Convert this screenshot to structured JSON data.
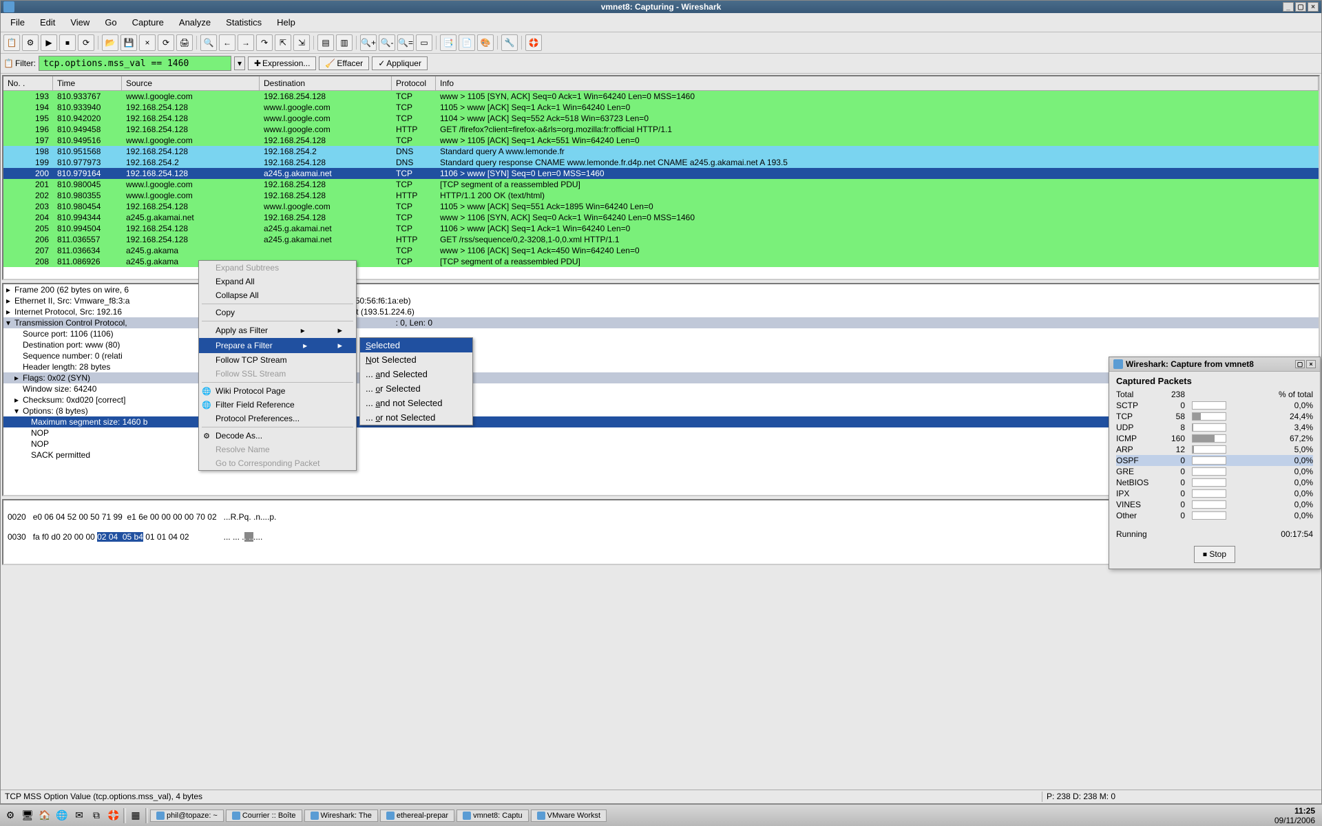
{
  "window": {
    "title": "vmnet8: Capturing - Wireshark"
  },
  "menubar": [
    "File",
    "Edit",
    "View",
    "Go",
    "Capture",
    "Analyze",
    "Statistics",
    "Help"
  ],
  "filter": {
    "label": "Filter:",
    "value": "tcp.options.mss_val == 1460",
    "expression": "Expression...",
    "clear": "Effacer",
    "apply": "Appliquer"
  },
  "columns": {
    "no": "No. .",
    "time": "Time",
    "src": "Source",
    "dst": "Destination",
    "proto": "Protocol",
    "info": "Info"
  },
  "packets": [
    {
      "no": "193",
      "time": "810.933767",
      "src": "www.l.google.com",
      "dst": "192.168.254.128",
      "proto": "TCP",
      "info": "www > 1105 [SYN, ACK] Seq=0 Ack=1 Win=64240 Len=0 MSS=1460",
      "cls": "green"
    },
    {
      "no": "194",
      "time": "810.933940",
      "src": "192.168.254.128",
      "dst": "www.l.google.com",
      "proto": "TCP",
      "info": "1105 > www [ACK] Seq=1 Ack=1 Win=64240 Len=0",
      "cls": "green"
    },
    {
      "no": "195",
      "time": "810.942020",
      "src": "192.168.254.128",
      "dst": "www.l.google.com",
      "proto": "TCP",
      "info": "1104 > www [ACK] Seq=552 Ack=518 Win=63723 Len=0",
      "cls": "green"
    },
    {
      "no": "196",
      "time": "810.949458",
      "src": "192.168.254.128",
      "dst": "www.l.google.com",
      "proto": "HTTP",
      "info": "GET /firefox?client=firefox-a&rls=org.mozilla:fr:official HTTP/1.1",
      "cls": "green"
    },
    {
      "no": "197",
      "time": "810.949516",
      "src": "www.l.google.com",
      "dst": "192.168.254.128",
      "proto": "TCP",
      "info": "www > 1105 [ACK] Seq=1 Ack=551 Win=64240 Len=0",
      "cls": "green"
    },
    {
      "no": "198",
      "time": "810.951568",
      "src": "192.168.254.128",
      "dst": "192.168.254.2",
      "proto": "DNS",
      "info": "Standard query A www.lemonde.fr",
      "cls": "blue"
    },
    {
      "no": "199",
      "time": "810.977973",
      "src": "192.168.254.2",
      "dst": "192.168.254.128",
      "proto": "DNS",
      "info": "Standard query response CNAME www.lemonde.fr.d4p.net CNAME a245.g.akamai.net A 193.5",
      "cls": "blue"
    },
    {
      "no": "200",
      "time": "810.979164",
      "src": "192.168.254.128",
      "dst": "a245.g.akamai.net",
      "proto": "TCP",
      "info": "1106 > www [SYN] Seq=0 Len=0 MSS=1460",
      "cls": "darkblue"
    },
    {
      "no": "201",
      "time": "810.980045",
      "src": "www.l.google.com",
      "dst": "192.168.254.128",
      "proto": "TCP",
      "info": "[TCP segment of a reassembled PDU]",
      "cls": "green"
    },
    {
      "no": "202",
      "time": "810.980355",
      "src": "www.l.google.com",
      "dst": "192.168.254.128",
      "proto": "HTTP",
      "info": "HTTP/1.1 200 OK (text/html)",
      "cls": "green"
    },
    {
      "no": "203",
      "time": "810.980454",
      "src": "192.168.254.128",
      "dst": "www.l.google.com",
      "proto": "TCP",
      "info": "1105 > www [ACK] Seq=551 Ack=1895 Win=64240 Len=0",
      "cls": "green"
    },
    {
      "no": "204",
      "time": "810.994344",
      "src": "a245.g.akamai.net",
      "dst": "192.168.254.128",
      "proto": "TCP",
      "info": "www > 1106 [SYN, ACK] Seq=0 Ack=1 Win=64240 Len=0 MSS=1460",
      "cls": "green"
    },
    {
      "no": "205",
      "time": "810.994504",
      "src": "192.168.254.128",
      "dst": "a245.g.akamai.net",
      "proto": "TCP",
      "info": "1106 > www [ACK] Seq=1 Ack=1 Win=64240 Len=0",
      "cls": "green"
    },
    {
      "no": "206",
      "time": "811.036557",
      "src": "192.168.254.128",
      "dst": "a245.g.akamai.net",
      "proto": "HTTP",
      "info": "GET /rss/sequence/0,2-3208,1-0,0.xml HTTP/1.1",
      "cls": "green"
    },
    {
      "no": "207",
      "time": "811.036634",
      "src": "a245.g.akama",
      "dst": "",
      "proto": "TCP",
      "info": "www > 1106 [ACK] Seq=1 Ack=450 Win=64240 Len=0",
      "cls": "green"
    },
    {
      "no": "208",
      "time": "811.086926",
      "src": "a245.g.akama",
      "dst": "",
      "proto": "TCP",
      "info": "[TCP segment of a reassembled PDU]",
      "cls": "green"
    }
  ],
  "details": {
    "frame": "Frame 200 (62 bytes on wire, 6",
    "eth": "Ethernet II, Src: Vmware_f8:3:a",
    "eth_rest": ": 192.168.254.2 (00:50:56:f6:1a:eb)",
    "ip": "Internet Protocol, Src: 192.16",
    "ip_rest": "Dst: a245.g.akamai.net (193.51.224.6)",
    "tcp": "Transmission Control Protocol,",
    "tcp_rest": ": 0, Len: 0",
    "srcport": "Source port: 1106 (1106)",
    "dstport": "Destination port: www (80)",
    "seq": "Sequence number: 0    (relati",
    "hdrlen": "Header length: 28 bytes",
    "flags": "Flags: 0x02 (SYN)",
    "win": "Window size: 64240",
    "chk": "Checksum: 0xd020 [correct]",
    "opts": "Options: (8 bytes)",
    "mss": "Maximum segment size: 1460 b",
    "nop1": "NOP",
    "nop2": "NOP",
    "sack": "SACK permitted"
  },
  "hex": {
    "line1_off": "0020",
    "line1_hex": "e0 06 04 52 00 50 71 99  e1 6e 00 00 00 00 70 02",
    "line1_asc": "...R.Pq. .n....p.",
    "line2_off": "0030",
    "line2_hex_a": "fa f0 d0 20 00 00 ",
    "line2_hex_sel": "02 04  05 b4",
    "line2_hex_b": " 01 01 04 02",
    "line2_asc_a": "... ... .",
    "line2_asc_sel": ". ..",
    "line2_asc_b": "...."
  },
  "status": {
    "left": "TCP MSS Option Value (tcp.options.mss_val), 4 bytes",
    "mid": "P: 238 D: 238 M: 0"
  },
  "context": {
    "items": [
      {
        "label": "Expand Subtrees",
        "disabled": true
      },
      {
        "label": "Expand All"
      },
      {
        "label": "Collapse All"
      },
      {
        "sep": true
      },
      {
        "label": "Copy"
      },
      {
        "sep": true
      },
      {
        "label": "Apply as Filter",
        "sub": true
      },
      {
        "label": "Prepare a Filter",
        "sub": true,
        "hl": true
      },
      {
        "label": "Follow TCP Stream"
      },
      {
        "label": "Follow SSL Stream",
        "disabled": true
      },
      {
        "sep": true
      },
      {
        "label": "Wiki Protocol Page",
        "icon": "🌐"
      },
      {
        "label": "Filter Field Reference",
        "icon": "🌐"
      },
      {
        "label": "Protocol Preferences..."
      },
      {
        "sep": true
      },
      {
        "label": "Decode As...",
        "icon": "⚙"
      },
      {
        "label": "Resolve Name",
        "disabled": true
      },
      {
        "label": "Go to Corresponding Packet",
        "disabled": true
      }
    ]
  },
  "submenu": [
    "Selected",
    "Not Selected",
    "... and Selected",
    "... or Selected",
    "... and not Selected",
    "... or not Selected"
  ],
  "capture": {
    "title": "Wireshark: Capture from vmnet8",
    "heading": "Captured Packets",
    "total_label": "Total",
    "total": "238",
    "pct_label": "% of total",
    "rows": [
      {
        "nm": "SCTP",
        "cnt": "0",
        "pct": "0,0%",
        "w": 0
      },
      {
        "nm": "TCP",
        "cnt": "58",
        "pct": "24,4%",
        "w": 24
      },
      {
        "nm": "UDP",
        "cnt": "8",
        "pct": "3,4%",
        "w": 3
      },
      {
        "nm": "ICMP",
        "cnt": "160",
        "pct": "67,2%",
        "w": 67
      },
      {
        "nm": "ARP",
        "cnt": "12",
        "pct": "5,0%",
        "w": 5
      },
      {
        "nm": "OSPF",
        "cnt": "0",
        "pct": "0,0%",
        "w": 0,
        "hl": true
      },
      {
        "nm": "GRE",
        "cnt": "0",
        "pct": "0,0%",
        "w": 0
      },
      {
        "nm": "NetBIOS",
        "cnt": "0",
        "pct": "0,0%",
        "w": 0
      },
      {
        "nm": "IPX",
        "cnt": "0",
        "pct": "0,0%",
        "w": 0
      },
      {
        "nm": "VINES",
        "cnt": "0",
        "pct": "0,0%",
        "w": 0
      },
      {
        "nm": "Other",
        "cnt": "0",
        "pct": "0,0%",
        "w": 0
      }
    ],
    "running": "Running",
    "time": "00:17:54",
    "stop": "Stop"
  },
  "taskbar": {
    "tasks": [
      "phil@topaze: ~",
      "Courrier :: Boîte",
      "Wireshark: The",
      "ethereal-prepar",
      "vmnet8: Captu",
      "VMware Workst"
    ],
    "clock_time": "11:25",
    "clock_date": "09/11/2006"
  }
}
